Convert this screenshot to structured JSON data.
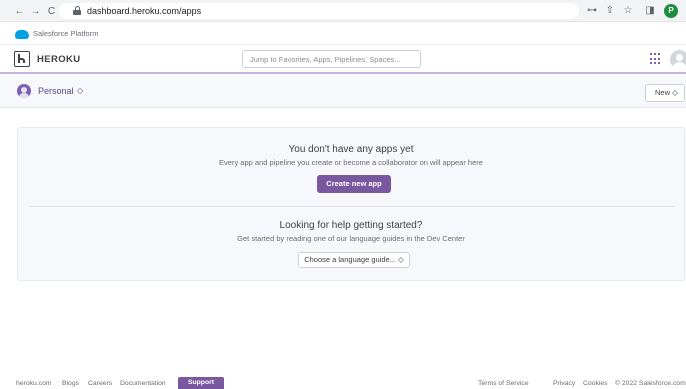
{
  "browser": {
    "back": "←",
    "forward": "→",
    "reload": "C",
    "url": "dashboard.heroku.com/apps",
    "profile_initial": "P"
  },
  "salesforce": {
    "label": "Salesforce Platform"
  },
  "header": {
    "brand": "HEROKU",
    "search_placeholder": "Jump to Favorites, Apps, Pipelines, Spaces..."
  },
  "subheader": {
    "team": "Personal",
    "team_caret": "◇",
    "new_button": "New ◇"
  },
  "empty_state": {
    "title": "You don't have any apps yet",
    "subtitle": "Every app and pipeline you create or become a collaborator on will appear here",
    "create_button": "Create new app"
  },
  "help": {
    "title": "Looking for help getting started?",
    "subtitle": "Get started by reading one of our language guides in the Dev Center",
    "select_label": "Choose a language guide... ◇"
  },
  "footer": {
    "left_links": [
      "heroku.com",
      "Blogs",
      "Careers",
      "Documentation"
    ],
    "support": "Support",
    "right_links": [
      "Terms of Service",
      "Privacy",
      "Cookies",
      "© 2022 Salesforce.com"
    ]
  },
  "colors": {
    "accent": "#79589f",
    "header_border": "#c1b4df",
    "panel_bg": "#f7f8fb"
  }
}
